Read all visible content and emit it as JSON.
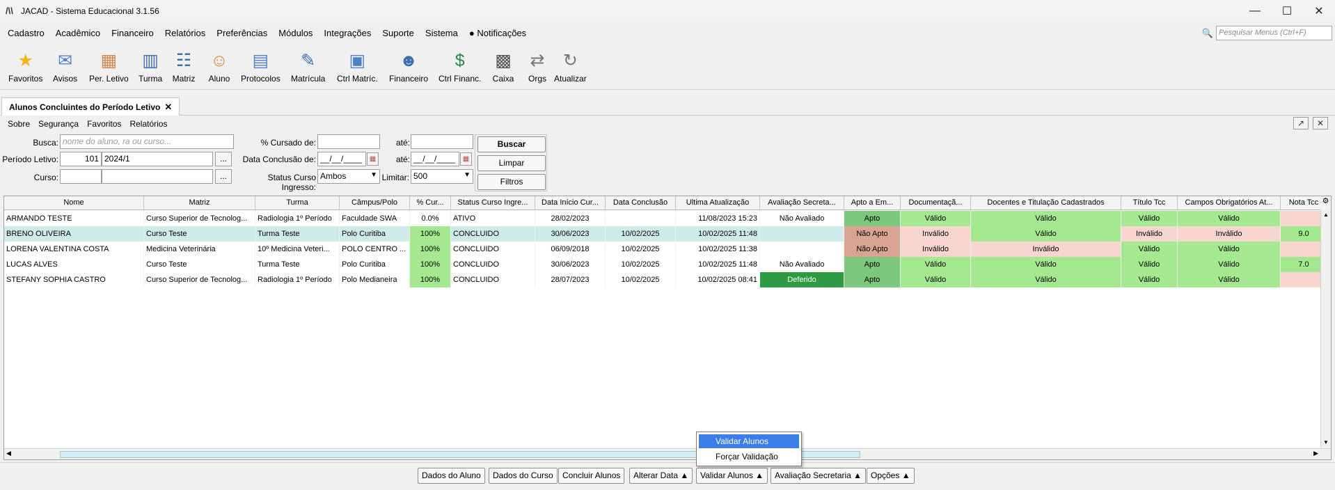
{
  "window": {
    "title": "JACAD - Sistema Educacional 3.1.56",
    "logo": "/\\\\"
  },
  "menu": {
    "items": [
      "Cadastro",
      "Acadêmico",
      "Financeiro",
      "Relatórios",
      "Preferências",
      "Módulos",
      "Integrações",
      "Suporte",
      "Sistema"
    ],
    "notifications": "Notificações",
    "search_placeholder": "Pesquisar Menus (Ctrl+F)"
  },
  "toolbar": [
    {
      "label": "Favoritos",
      "icon": "star-icon",
      "glyph": "★",
      "color": "#f2b619"
    },
    {
      "label": "Avisos",
      "icon": "envelope-icon",
      "glyph": "✉",
      "color": "#4f7fc9"
    },
    {
      "label": "Per. Letivo",
      "icon": "calendar-icon",
      "glyph": "▦",
      "color": "#d1884a"
    },
    {
      "label": "Turma",
      "icon": "group-icon",
      "glyph": "▥",
      "color": "#3f6fae"
    },
    {
      "label": "Matriz",
      "icon": "matrix-icon",
      "glyph": "☷",
      "color": "#3f6fae"
    },
    {
      "label": "Aluno",
      "icon": "student-icon",
      "glyph": "☺",
      "color": "#c98b3e"
    },
    {
      "label": "Protocolos",
      "icon": "protocol-icon",
      "glyph": "▤",
      "color": "#4f7fc9"
    },
    {
      "label": "Matrícula",
      "icon": "enrollment-icon",
      "glyph": "✎",
      "color": "#3f6fae"
    },
    {
      "label": "Ctrl Matríc.",
      "icon": "enrollment-control-icon",
      "glyph": "▣",
      "color": "#4f7fc9"
    },
    {
      "label": "Financeiro",
      "icon": "finance-icon",
      "glyph": "☻",
      "color": "#3f6fae"
    },
    {
      "label": "Ctrl Financ.",
      "icon": "money-control-icon",
      "glyph": "$",
      "color": "#2a8a4a"
    },
    {
      "label": "Caixa",
      "icon": "cash-register-icon",
      "glyph": "▩",
      "color": "#555555"
    },
    {
      "label": "Orgs",
      "icon": "orgs-icon",
      "glyph": "⇄",
      "color": "#777777"
    },
    {
      "label": "Atualizar",
      "icon": "refresh-icon",
      "glyph": "↻",
      "color": "#777777"
    }
  ],
  "tab": {
    "title": "Alunos Concluintes do Período Letivo",
    "close": "✕"
  },
  "submenu": [
    "Sobre",
    "Segurança",
    "Favoritos",
    "Relatórios"
  ],
  "filters": {
    "busca_label": "Busca:",
    "busca_placeholder": "nome do aluno, ra ou curso...",
    "periodo_label": "Período Letivo:",
    "periodo_code": "101",
    "periodo_value": "2024/1",
    "curso_label": "Curso:",
    "curso_code": "",
    "curso_value": "",
    "dots": "...",
    "cursado_label": "% Cursado de:",
    "cursado_de": "",
    "ate_label": "até:",
    "cursado_ate": "",
    "conclusao_label": "Data Conclusão de:",
    "conclusao_de": "__/__/____",
    "conclusao_ate": "__/__/____",
    "status_label": "Status Curso Ingresso:",
    "status_value": "Ambos",
    "limitar_label": "Limitar:",
    "limitar_value": "500",
    "buscar": "Buscar",
    "limpar": "Limpar",
    "filtros": "Filtros"
  },
  "grid": {
    "columns": [
      "Nome",
      "Matriz",
      "Turma",
      "Câmpus/Polo",
      "% Cur...",
      "Status Curso Ingre...",
      "Data Início Cur...",
      "Data Conclusão",
      "Ultima Atualização",
      "Avaliação Secreta...",
      "Apto a Em...",
      "Documentaçã...",
      "Docentes e Titulação Cadastrados",
      "Título Tcc",
      "Campos Obrigatórios At...",
      "Nota Tcc"
    ],
    "rows": [
      [
        "ARMANDO TESTE",
        "Curso Superior de Tecnolog...",
        "Radiologia 1º Período",
        "Faculdade SWA",
        "0.0%",
        "ATIVO",
        "28/02/2023",
        "",
        "11/08/2023 15:23",
        "Não Avaliado",
        "Apto",
        "Válido",
        "Válido",
        "Válido",
        "Válido",
        ""
      ],
      [
        "BRENO OLIVEIRA",
        "Curso Teste",
        "Turma Teste",
        "Polo Curitiba",
        "100%",
        "CONCLUIDO",
        "30/06/2023",
        "10/02/2025",
        "10/02/2025 11:48",
        "",
        "Não Apto",
        "Inválido",
        "Válido",
        "Inválido",
        "Inválido",
        "9.0"
      ],
      [
        "LORENA VALENTINA COSTA",
        "Medicina Veterinária",
        "10º Medicina Veteri...",
        "POLO CENTRO ...",
        "100%",
        "CONCLUIDO",
        "06/09/2018",
        "10/02/2025",
        "10/02/2025 11:38",
        "",
        "Não Apto",
        "Inválido",
        "Inválido",
        "Válido",
        "Válido",
        ""
      ],
      [
        "LUCAS ALVES",
        "Curso Teste",
        "Turma Teste",
        "Polo Curitiba",
        "100%",
        "CONCLUIDO",
        "30/06/2023",
        "10/02/2025",
        "10/02/2025 11:48",
        "Não Avaliado",
        "Apto",
        "Válido",
        "Válido",
        "Válido",
        "Válido",
        "7.0"
      ],
      [
        "STEFANY SOPHIA CASTRO",
        "Curso Superior de Tecnolog...",
        "Radiologia 1º Período",
        "Polo Medianeira",
        "100%",
        "CONCLUIDO",
        "28/07/2023",
        "10/02/2025",
        "10/02/2025 08:41",
        "Deferido",
        "Apto",
        "Válido",
        "Válido",
        "Válido",
        "Válido",
        ""
      ]
    ]
  },
  "popup": {
    "items": [
      "Validar Alunos",
      "Forçar Validação"
    ]
  },
  "bottom": [
    "Dados do Aluno",
    "Dados do Curso",
    "Concluir Alunos",
    "Alterar Data ▲",
    "Validar Alunos ▲",
    "Avaliação Secretaria ▲",
    "Opções ▲"
  ]
}
